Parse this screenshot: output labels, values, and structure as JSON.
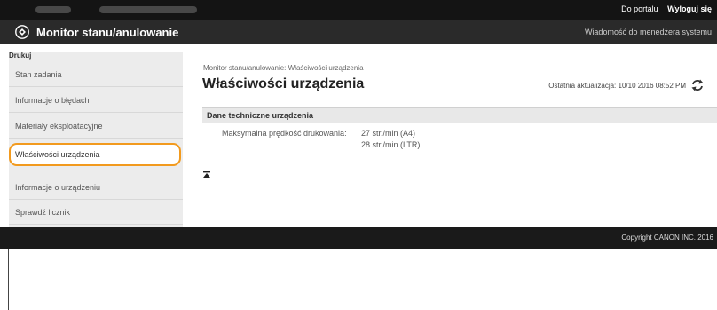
{
  "top_bar": {
    "portal_label": "Do portalu",
    "logout_label": "Wyloguj się"
  },
  "header": {
    "app_title": "Monitor stanu/anulowanie",
    "manager_message": "Wiadomość do menedżera systemu"
  },
  "sidebar": {
    "heading": "Drukuj",
    "items": [
      {
        "label": "Stan zadania"
      },
      {
        "label": "Informacje o błędach"
      },
      {
        "label": "Materiały eksploatacyjne"
      },
      {
        "label": "Właściwości urządzenia"
      },
      {
        "label": "Informacje o urządzeniu"
      },
      {
        "label": "Sprawdź licznik"
      }
    ]
  },
  "main": {
    "breadcrumb": "Monitor stanu/anulowanie: Właściwości urządzenia",
    "title": "Właściwości urządzenia",
    "last_update": "Ostatnia aktualizacja: 10/10 2016 08:52 PM",
    "section_title": "Dane techniczne urządzenia",
    "spec_label": "Maksymalna prędkość drukowania:",
    "spec_values": [
      "27 str./min (A4)",
      "28 str./min (LTR)"
    ]
  },
  "footer": {
    "copyright": "Copyright CANON INC. 2016"
  },
  "colors": {
    "highlight": "#f29a1e",
    "header_bg": "#2a2a2a",
    "topbar_bg": "#141414"
  }
}
